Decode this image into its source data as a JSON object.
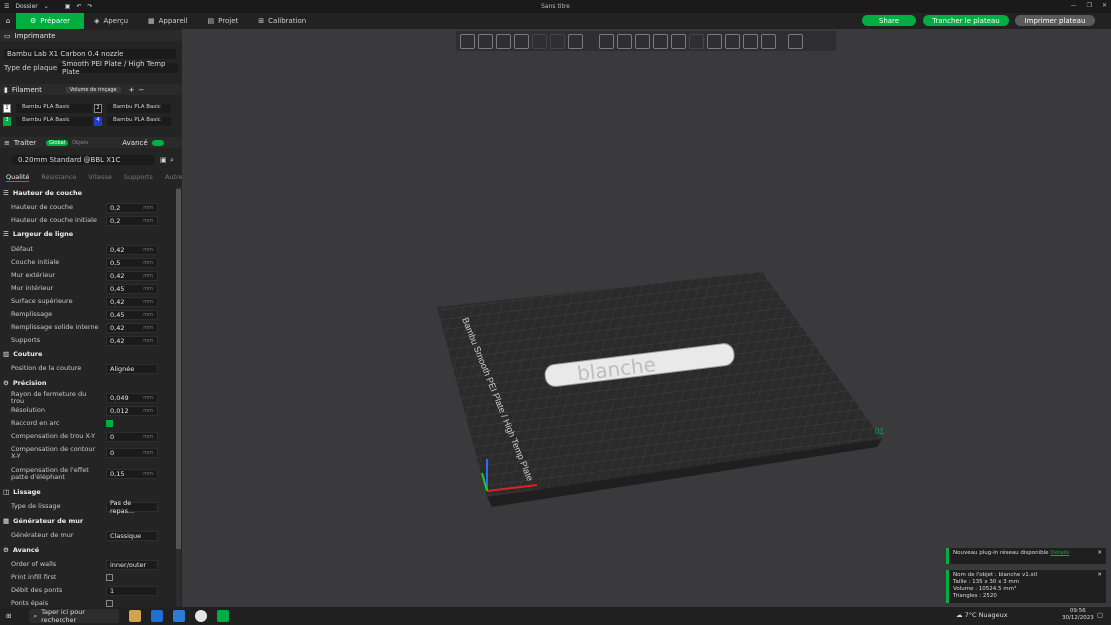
{
  "window": {
    "title": "Sans titre",
    "menu_label": "Dossier"
  },
  "tabs": [
    {
      "label": "Préparer"
    },
    {
      "label": "Aperçu"
    },
    {
      "label": "Appareil"
    },
    {
      "label": "Projet"
    },
    {
      "label": "Calibration"
    }
  ],
  "actions": {
    "share": "Share",
    "slice": "Trancher le plateau",
    "print": "Imprimer plateau"
  },
  "printer": {
    "section": "Imprimante",
    "model": "Bambu Lab X1 Carbon 0.4 nozzle",
    "plate_label": "Type de plaque",
    "plate_value": "Smooth PEI Plate / High Temp Plate"
  },
  "filament": {
    "section": "Filament",
    "volume_button": "Volume de rinçage",
    "slots": [
      {
        "num": "1",
        "name": "Bambu PLA Basic",
        "color": "#ffffff"
      },
      {
        "num": "2",
        "name": "Bambu PLA Basic",
        "color": "#111111"
      },
      {
        "num": "3",
        "name": "Bambu PLA Basic",
        "color": "#00ae42"
      },
      {
        "num": "4",
        "name": "Bambu PLA Basic",
        "color": "#1f3ad6"
      }
    ]
  },
  "process": {
    "section": "Traiter",
    "global_label": "Global",
    "objects_label": "Objets",
    "advanced_label": "Avancé",
    "preset": "0.20mm Standard @BBL X1C",
    "tabs": [
      "Qualité",
      "Résistance",
      "Vitesse",
      "Supports",
      "Autre"
    ]
  },
  "settings": {
    "layer_height": {
      "title": "Hauteur de couche",
      "layer": "Hauteur de couche",
      "layer_val": "0,2",
      "first": "Hauteur de couche initiale",
      "first_val": "0,2"
    },
    "line_width": {
      "title": "Largeur de ligne",
      "default": "Défaut",
      "default_val": "0,42",
      "initial": "Couche initiale",
      "initial_val": "0,5",
      "outer": "Mur extérieur",
      "outer_val": "0,42",
      "inner": "Mur intérieur",
      "inner_val": "0,45",
      "top": "Surface supérieure",
      "top_val": "0,42",
      "infill": "Remplissage",
      "infill_val": "0,45",
      "solid": "Remplissage solide interne",
      "solid_val": "0,42",
      "support": "Supports",
      "support_val": "0,42"
    },
    "seam": {
      "title": "Couture",
      "pos": "Position de la couture",
      "pos_val": "Alignée"
    },
    "precision": {
      "title": "Précision",
      "hole": "Rayon de fermeture du trou",
      "hole_val": "0,049",
      "res": "Résolution",
      "res_val": "0,012",
      "arc": "Raccord en arc",
      "xy_hole": "Compensation de trou X-Y",
      "xy_hole_val": "0",
      "xy_contour": "Compensation de contour X-Y",
      "xy_contour_val": "0",
      "foot": "Compensation de l'effet patte d'éléphant",
      "foot_val": "0,15"
    },
    "ironing": {
      "title": "Lissage",
      "type": "Type de lissage",
      "type_val": "Pas de repas..."
    },
    "wall_gen": {
      "title": "Générateur de mur",
      "gen": "Générateur de mur",
      "gen_val": "Classique"
    },
    "advanced": {
      "title": "Avancé",
      "order": "Order of walls",
      "order_val": "inner/outer",
      "print_infill_first": "Print infill first",
      "bridge_flow": "Débit des ponts",
      "bridge_flow_val": "1",
      "thick_bridges": "Ponts épais"
    },
    "unit": "mm"
  },
  "viewport": {
    "object_text": "blanche",
    "plate_text": "Bambu Smooth PEI Plate / High Temp Plate",
    "plate_number": "01"
  },
  "notifications": {
    "plugin": "Nouveau plug-in réseau disponible",
    "plugin_link": "Détails",
    "obj_name": "Nom de l'objet : blanche v1.stl",
    "obj_size": "Taille : 135 x 30 x 3 mm",
    "obj_volume": "Volume : 10524.5 mm³",
    "obj_tri": "Triangles : 2520"
  },
  "taskbar": {
    "search": "Taper ici pour rechercher",
    "weather": "7°C Nuageux",
    "time": "09:56",
    "date": "30/12/2023"
  }
}
